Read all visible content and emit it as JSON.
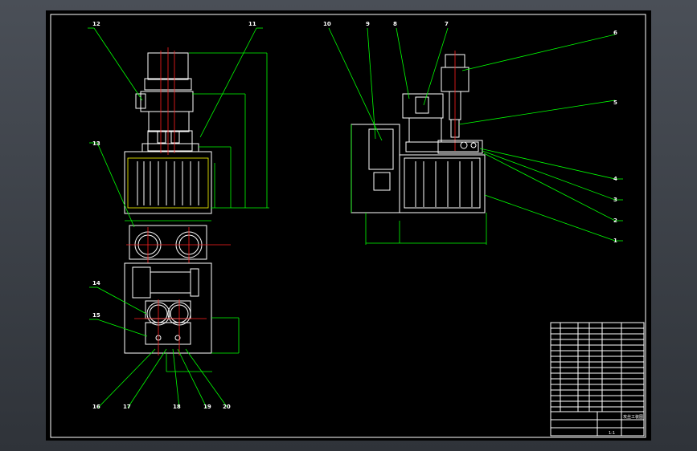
{
  "drawing": {
    "part_labels": {
      "l1": "1",
      "l2": "2",
      "l3": "3",
      "l4": "4",
      "l5": "5",
      "l6": "6",
      "l7": "7",
      "l8": "8",
      "l9": "9",
      "l10": "10",
      "l11": "11",
      "l12": "12",
      "l13": "13",
      "l14": "14",
      "l15": "15",
      "l16": "16",
      "l17": "17",
      "l18": "18",
      "l19": "19",
      "l20": "20"
    },
    "title_block": {
      "drawing_name": "攻丝工装图",
      "scale": "1:1"
    }
  },
  "colors": {
    "background": "#000000",
    "outline": "#ffffff",
    "leader": "#00ff00",
    "centerline": "#ff2020",
    "hidden": "#ffff00"
  }
}
